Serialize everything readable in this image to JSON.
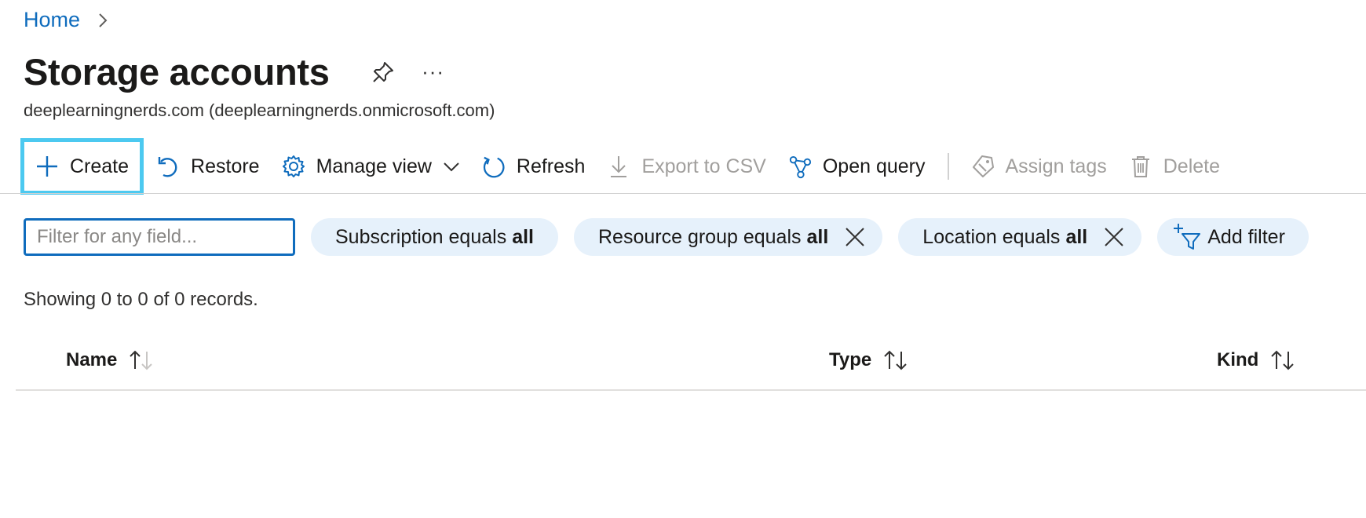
{
  "breadcrumb": {
    "home": "Home"
  },
  "page": {
    "title": "Storage accounts",
    "subtitle": "deeplearningnerds.com (deeplearningnerds.onmicrosoft.com)",
    "more": "···"
  },
  "toolbar": {
    "create": "Create",
    "restore": "Restore",
    "manage_view": "Manage view",
    "refresh": "Refresh",
    "export_csv": "Export to CSV",
    "open_query": "Open query",
    "assign_tags": "Assign tags",
    "delete": "Delete"
  },
  "filters": {
    "placeholder": "Filter for any field...",
    "pills": [
      {
        "label": "Subscription equals",
        "value": "all"
      },
      {
        "label": "Resource group equals",
        "value": "all"
      },
      {
        "label": "Location equals",
        "value": "all"
      }
    ],
    "add_filter": "Add filter"
  },
  "records_text": "Showing 0 to 0 of 0 records.",
  "table": {
    "columns": [
      "Name",
      "Type",
      "Kind"
    ]
  },
  "colors": {
    "accent": "#0f6cbd",
    "create_highlight": "#4cc9f0",
    "pill_bg": "#e6f1fb",
    "disabled": "#a19f9d"
  }
}
